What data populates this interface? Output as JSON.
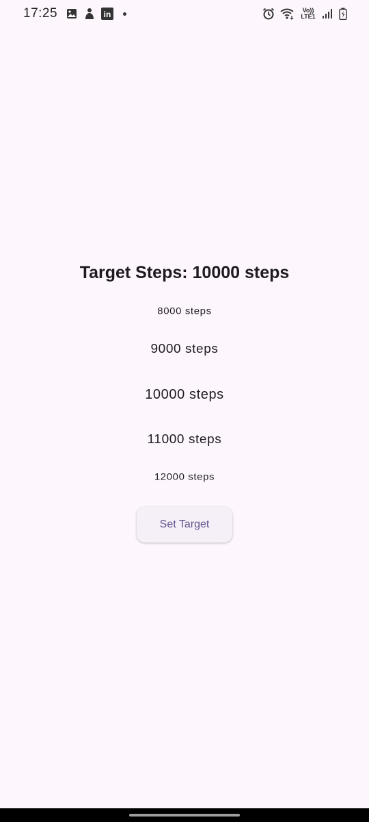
{
  "status_bar": {
    "time": "17:25",
    "left_icons": [
      "gallery-icon",
      "person-icon",
      "linkedin-icon",
      "notification-dot-icon"
    ],
    "right_icons": [
      "alarm-icon",
      "wifi-icon",
      "volte-icon",
      "signal-icon",
      "battery-icon"
    ],
    "volte_label_top": "Vo))",
    "volte_label_bottom": "LTE1",
    "linkedin_label": "in"
  },
  "main": {
    "title": "Target Steps: 10000 steps",
    "picker": {
      "items": [
        "8000 steps",
        "9000 steps",
        "10000 steps",
        "11000 steps",
        "12000 steps"
      ],
      "selected": "10000 steps"
    },
    "set_target_label": "Set Target"
  },
  "colors": {
    "background": "#fdf7fd",
    "button_text": "#65558f",
    "button_bg": "#f5eff7"
  }
}
